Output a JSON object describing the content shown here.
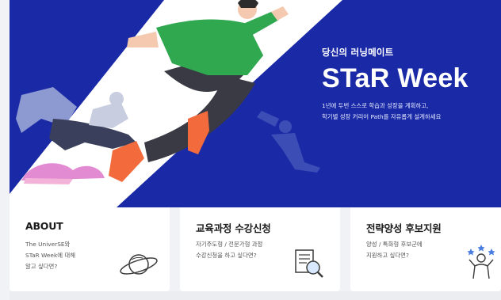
{
  "hero": {
    "kicker": "당신의 러닝메이트",
    "title": "STaR Week",
    "desc_line1": "1년에 두번 스스로 학습과 성장을 계획하고,",
    "desc_line2": "학기별 성장 커리어 Path를 자유롭게 설계하세요"
  },
  "cards": [
    {
      "title": "ABOUT",
      "desc": "The UniverSE와\nSTaR Week에 대해\n알고 싶다면?",
      "icon": "planet-icon"
    },
    {
      "title": "교육과정 수강신청",
      "desc": "자기주도형 / 전문가형 과정\n수강신청을 하고 싶다면?",
      "icon": "document-search-icon"
    },
    {
      "title": "전략양성 후보지원",
      "desc": "양성 / 특화형 후보군에\n지원하고 싶다면?",
      "icon": "person-stars-icon"
    }
  ],
  "colors": {
    "hero_bg": "#1a2aa6",
    "accent_green": "#2fa84f",
    "accent_orange": "#f36b3c"
  }
}
